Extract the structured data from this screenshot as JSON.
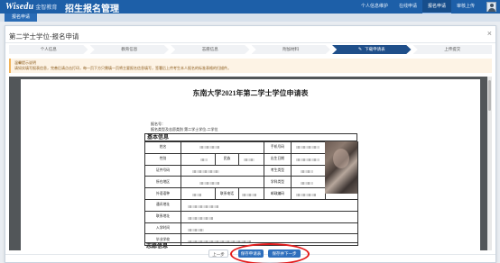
{
  "header": {
    "logo_en": "Wisedu",
    "logo_cn": "金智教育",
    "app_title": "招生报名管理",
    "nav": [
      {
        "label": "个人信息维护"
      },
      {
        "label": "在线申请"
      },
      {
        "label": "报名申请"
      },
      {
        "label": "审核上传"
      }
    ],
    "active_nav_index": 2
  },
  "subbar": {
    "tab_label": "报名申请"
  },
  "modal": {
    "title": "第二学士学位-报名申请",
    "close_glyph": "×",
    "steps": [
      {
        "label": "个人信息"
      },
      {
        "label": "教育信息"
      },
      {
        "label": "志愿信息"
      },
      {
        "label": "附加材料"
      },
      {
        "label": "下载申请表"
      },
      {
        "label": "上传提交"
      }
    ],
    "active_step_index": 4,
    "active_step_icon": "pencil-icon",
    "notice_title": "温馨提示说明",
    "notice_text": "请如实填写报表信息，完善后请点击打印，每一页下方只需填一页将主要报名信息填写，签署后上传考生本人报名的标准表格的扫描件。"
  },
  "document": {
    "title": "东南大学2021年第二学士学位申请表",
    "meta_number_label": "报名号：",
    "meta_category": "报名类型及志愿类别  第二学士学位-二学位",
    "section_basic": "基本信息",
    "section_next": "志愿信息",
    "rows": [
      [
        "姓名",
        "",
        "",
        "",
        "手机号码",
        ""
      ],
      [
        "性别",
        "",
        "民族",
        "",
        "出生日期",
        ""
      ],
      [
        "证件号码",
        "",
        "",
        "",
        "考生类型",
        ""
      ],
      [
        "所在地区",
        "",
        "",
        "",
        "学科类型",
        ""
      ],
      [
        "外语语种",
        "",
        "联系电话",
        "",
        "邮政编码",
        ""
      ],
      [
        "通讯地址",
        "",
        "",
        "",
        "",
        ""
      ],
      [
        "联系地址",
        "",
        "",
        "",
        "",
        ""
      ],
      [
        "入学时间",
        "",
        "",
        "",
        "",
        ""
      ],
      [
        "毕业学校",
        "",
        "",
        "",
        "",
        ""
      ]
    ]
  },
  "footer": {
    "prev_label": "上一步",
    "save_label": "保存申请表",
    "next_label": "保存并下一步"
  },
  "colors": {
    "brand_blue": "#1d5fa8",
    "active_step": "#1f4f8a",
    "primary_button": "#2e6fbd",
    "highlight_ring": "#e31b1b",
    "notice_bg": "#fdf3e5"
  }
}
